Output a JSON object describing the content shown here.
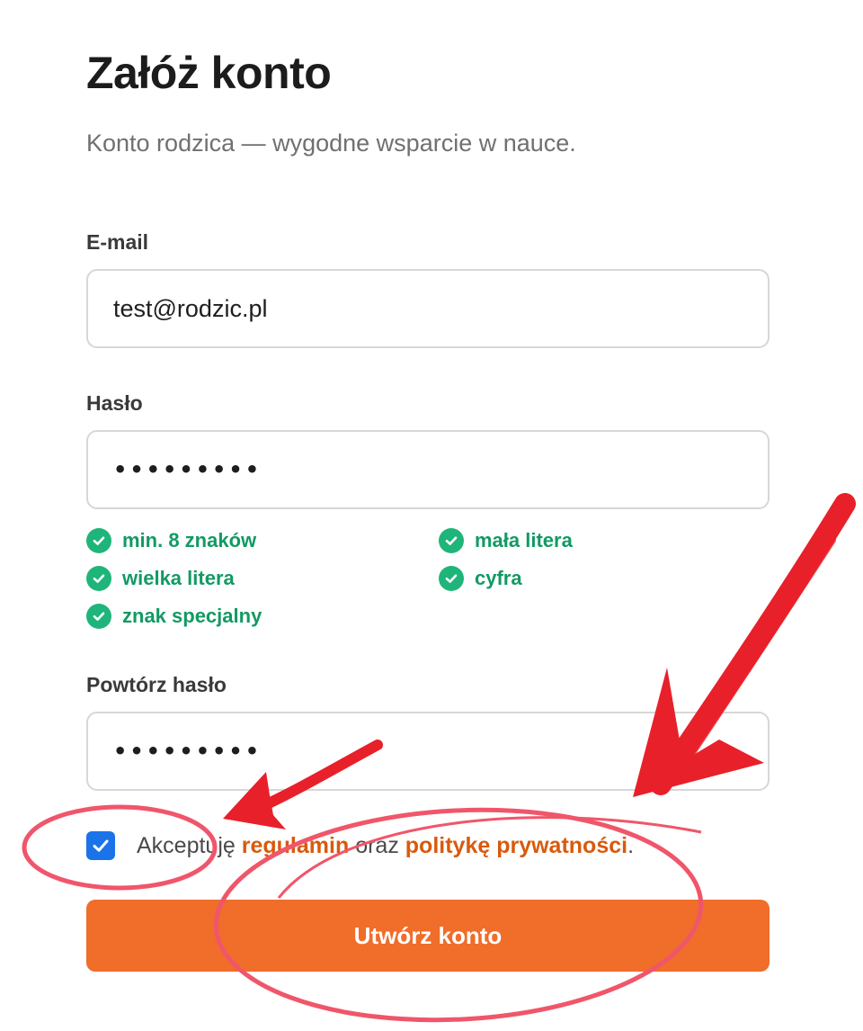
{
  "page": {
    "title": "Załóż konto",
    "subtitle": "Konto rodzica — wygodne wsparcie w nauce."
  },
  "form": {
    "email": {
      "label": "E-mail",
      "value": "test@rodzic.pl"
    },
    "password": {
      "label": "Hasło",
      "value": "•••••••••"
    },
    "password_requirements": [
      {
        "label": "min. 8 znaków",
        "met": true
      },
      {
        "label": "mała litera",
        "met": true
      },
      {
        "label": "wielka litera",
        "met": true
      },
      {
        "label": "cyfra",
        "met": true
      },
      {
        "label": "znak specjalny",
        "met": true
      }
    ],
    "confirm_password": {
      "label": "Powtórz hasło",
      "value": "•••••••••"
    },
    "terms": {
      "checked": true,
      "prefix": "Akceptuję",
      "terms_link": "regulamin",
      "connector": "oraz",
      "privacy_link": "politykę prywatności",
      "suffix": "."
    },
    "submit_label": "Utwórz konto"
  },
  "colors": {
    "accent": "#f06d2a",
    "link": "#d85a0d",
    "success": "#1fb57a",
    "checkbox": "#1a73e8",
    "annotation": "#e8202a"
  },
  "icons": {
    "requirement": "check-circle-icon",
    "checkbox": "checkmark-icon"
  }
}
